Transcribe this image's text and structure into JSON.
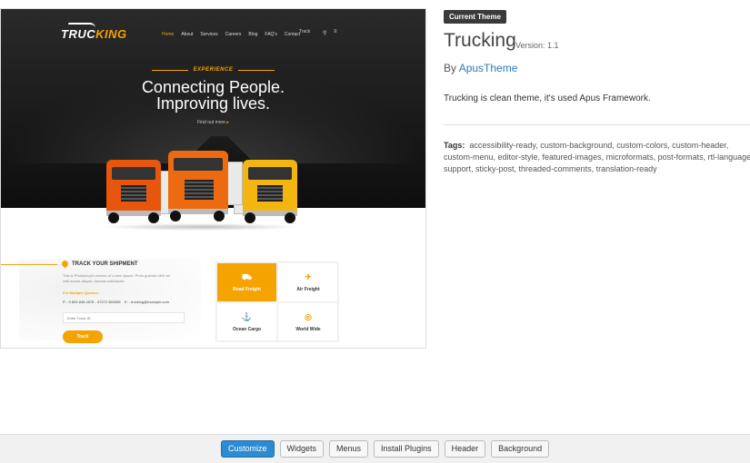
{
  "screenshot": {
    "logo": {
      "part1": "TRUC",
      "part2": "KING"
    },
    "menu": [
      "Home",
      "About",
      "Services",
      "Careers",
      "Blog",
      "FAQ's",
      "Contact"
    ],
    "search_text": "Track",
    "hero": {
      "kicker": "EXPERIENCE",
      "line1": "Connecting People.",
      "line2": "Improving lives.",
      "link": "Find out more"
    },
    "track": {
      "title": "TRACK YOUR SHIPMENT",
      "desc": "This is Photoshop's version of Lorem Ipsum. Proin gravida nibh vel velit auctor aliquet. Aenean sollicitudin.",
      "multi_label": "For Multiple Queries :",
      "phone": "P. : 0 800 848 4575 - 07272 650958",
      "email": "E. : trucking@example.com",
      "input_placeholder": "Enter Track ID",
      "button": "Track"
    },
    "services": [
      {
        "label": "Road Freight",
        "icon": "truck-icon"
      },
      {
        "label": "Air Freight",
        "icon": "plane-icon"
      },
      {
        "label": "Ocean Cargo",
        "icon": "ship-icon"
      },
      {
        "label": "World Wide",
        "icon": "globe-icon"
      }
    ]
  },
  "details": {
    "badge": "Current Theme",
    "name": "Trucking",
    "version": "Version: 1.1",
    "author_prefix": "By ",
    "author": "ApusTheme",
    "description": "Trucking is clean theme, it's used Apus Framework.",
    "tags_label": "Tags:",
    "tags": "accessibility-ready, custom-background, custom-colors, custom-header, custom-menu, editor-style, featured-images, microformats, post-formats, rtl-language-support, sticky-post, threaded-comments, translation-ready"
  },
  "actions": [
    "Customize",
    "Widgets",
    "Menus",
    "Install Plugins",
    "Header",
    "Background"
  ],
  "colors": {
    "accent": "#f5a300",
    "primary": "#2e8ad1",
    "link": "#2b7ab8"
  }
}
